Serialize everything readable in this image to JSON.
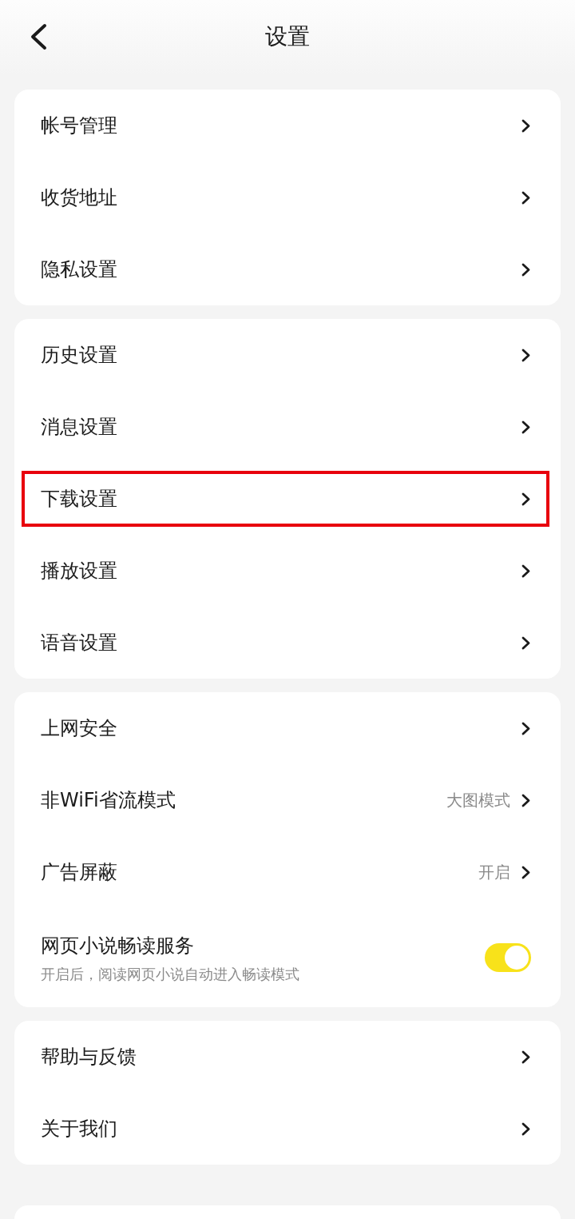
{
  "header": {
    "title": "设置"
  },
  "sections": [
    {
      "items": [
        {
          "kind": "link",
          "label": "帐号管理",
          "highlighted": false
        },
        {
          "kind": "link",
          "label": "收货地址",
          "highlighted": false
        },
        {
          "kind": "link",
          "label": "隐私设置",
          "highlighted": false
        }
      ]
    },
    {
      "items": [
        {
          "kind": "link",
          "label": "历史设置",
          "highlighted": false
        },
        {
          "kind": "link",
          "label": "消息设置",
          "highlighted": false
        },
        {
          "kind": "link",
          "label": "下载设置",
          "highlighted": true
        },
        {
          "kind": "link",
          "label": "播放设置",
          "highlighted": false
        },
        {
          "kind": "link",
          "label": "语音设置",
          "highlighted": false
        }
      ]
    },
    {
      "items": [
        {
          "kind": "link",
          "label": "上网安全",
          "highlighted": false
        },
        {
          "kind": "link",
          "label": "非WiFi省流模式",
          "value": "大图模式",
          "highlighted": false
        },
        {
          "kind": "link",
          "label": "广告屏蔽",
          "value": "开启",
          "highlighted": false
        },
        {
          "kind": "toggle",
          "label": "网页小说畅读服务",
          "description": "开启后，阅读网页小说自动进入畅读模式",
          "on": true
        }
      ]
    },
    {
      "items": [
        {
          "kind": "link",
          "label": "帮助与反馈",
          "highlighted": false
        },
        {
          "kind": "link",
          "label": "关于我们",
          "highlighted": false
        }
      ]
    }
  ]
}
